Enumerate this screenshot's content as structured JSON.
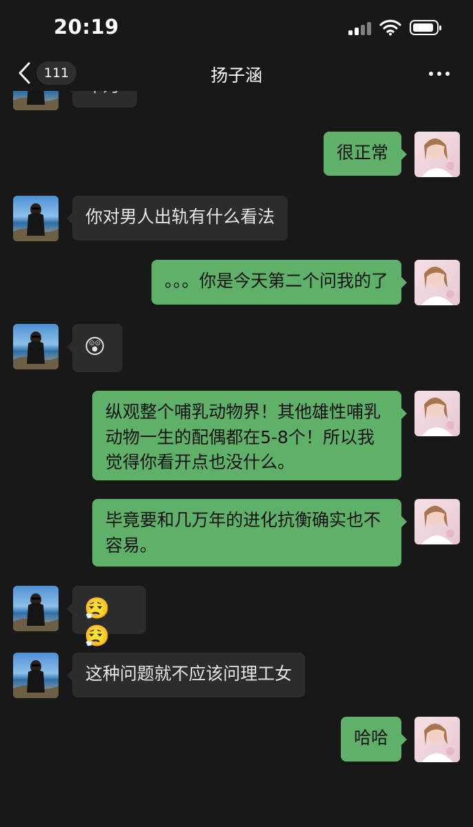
{
  "status_bar": {
    "time": "20:19"
  },
  "header": {
    "unread_badge": "111",
    "title": "扬子涵"
  },
  "messages": [
    {
      "side": "left",
      "text": "年为"
    },
    {
      "side": "right",
      "text": "很正常"
    },
    {
      "side": "left",
      "text": "你对男人出轨有什么看法"
    },
    {
      "side": "right",
      "text": "。。。你是今天第二个问我的了"
    },
    {
      "side": "left",
      "text": "😲",
      "icon": "surprised-emoji"
    },
    {
      "side": "right",
      "text": "纵观整个哺乳动物界！其他雄性哺乳动物一生的配偶都在5-8个！所以我觉得你看开点也没什么。"
    },
    {
      "side": "right",
      "text": "毕竟要和几万年的进化抗衡确实也不容易。"
    },
    {
      "side": "left",
      "text": "😮‍💨😮‍💨",
      "icon": "sigh-emoji"
    },
    {
      "side": "left",
      "text": "这种问题就不应该问理工女"
    },
    {
      "side": "right",
      "text": "哈哈"
    }
  ],
  "colors": {
    "background": "#181818",
    "sent_bubble": "#5fb069",
    "received_bubble": "#2c2c2c"
  }
}
